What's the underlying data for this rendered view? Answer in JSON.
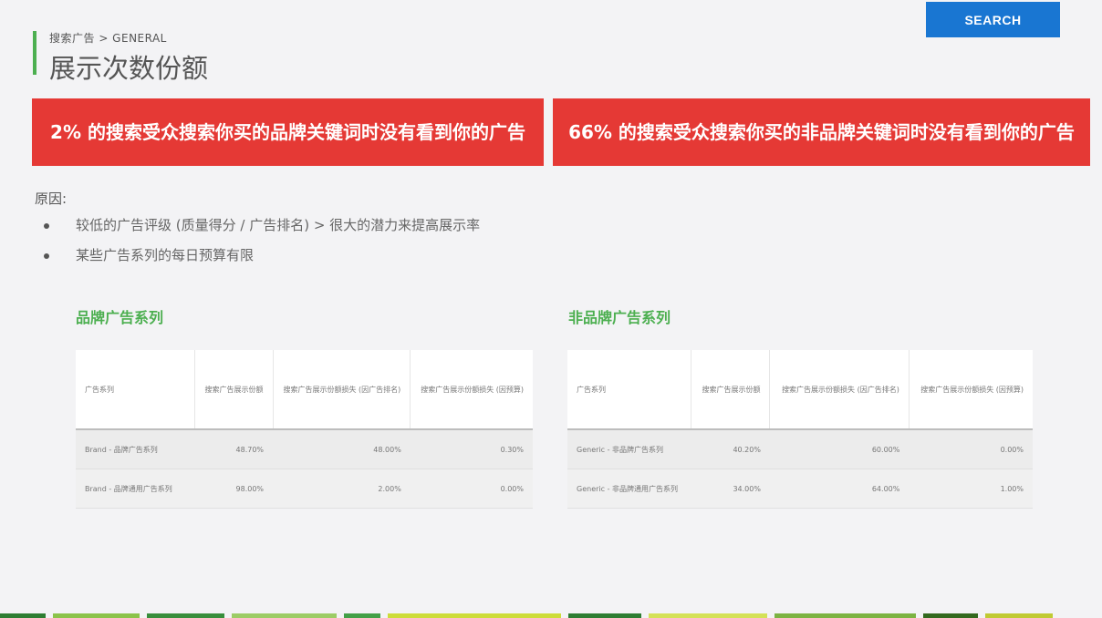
{
  "header": {
    "breadcrumb": "搜索广告 > GENERAL",
    "title": "展示次数份额",
    "search_button": "SEARCH"
  },
  "banners": {
    "left": "2% 的搜索受众搜索你买的品牌关键词时没有看到你的广告",
    "right": "66% 的搜索受众搜索你买的非品牌关键词时没有看到你的广告"
  },
  "reasons": {
    "label": "原因:",
    "items": [
      "较低的广告评级 (质量得分 / 广告排名) > 很大的潜力来提高展示率",
      "某些广告系列的每日预算有限"
    ]
  },
  "brand_section": {
    "title": "品牌广告系列",
    "headers": [
      "广告系列",
      "搜索广告展示份额",
      "搜索广告展示份额损失 (因广告排名)",
      "搜索广告展示份额损失 (因预算)"
    ],
    "rows": [
      [
        "Brand - 品牌广告系列",
        "48.70%",
        "48.00%",
        "0.30%"
      ],
      [
        "Brand - 品牌通用广告系列",
        "98.00%",
        "2.00%",
        "0.00%"
      ]
    ]
  },
  "nonbrand_section": {
    "title": "非品牌广告系列",
    "headers": [
      "广告系列",
      "搜索广告展示份额",
      "搜索广告展示份额损失 (因广告排名)",
      "搜索广告展示份额损失 (因预算)"
    ],
    "rows": [
      [
        "Generic - 非品牌广告系列",
        "40.20%",
        "60.00%",
        "0.00%"
      ],
      [
        "Generic - 非品牌通用广告系列",
        "34.00%",
        "64.00%",
        "1.00%"
      ]
    ]
  },
  "colors": {
    "banner": "#e53935",
    "accent": "#4caf50",
    "search_button": "#1976d2"
  }
}
